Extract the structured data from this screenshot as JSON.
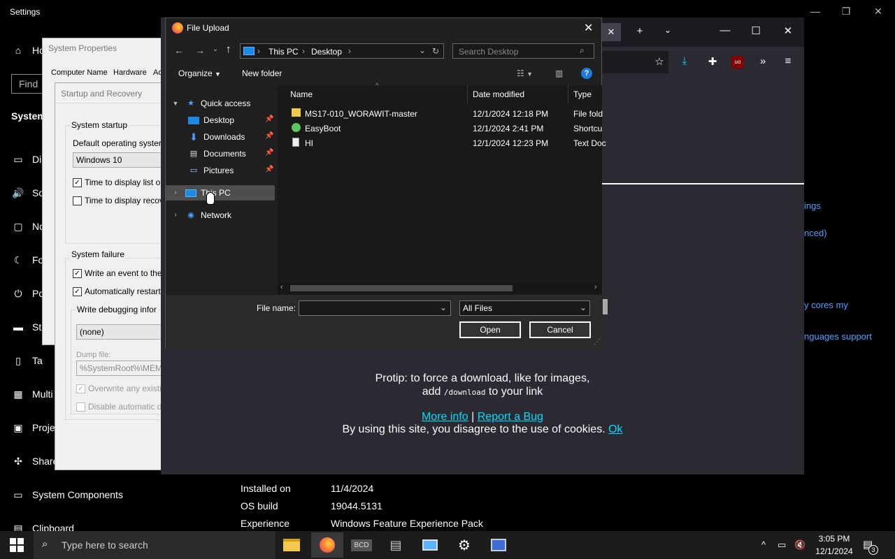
{
  "settings": {
    "title": "Settings",
    "home_label": "Ho",
    "find_placeholder": "Find",
    "section_label": "System",
    "nav": [
      {
        "icon": "display-icon",
        "glyph": "▭",
        "label": "Di"
      },
      {
        "icon": "sound-icon",
        "glyph": "🔊",
        "label": "So"
      },
      {
        "icon": "notifications-icon",
        "glyph": "▢",
        "label": "No"
      },
      {
        "icon": "focus-icon",
        "glyph": "☾",
        "label": "Fo"
      },
      {
        "icon": "power-icon",
        "glyph": "⏻",
        "label": "Po"
      },
      {
        "icon": "storage-icon",
        "glyph": "▬",
        "label": "St"
      },
      {
        "icon": "tablet-icon",
        "glyph": "▯",
        "label": "Ta"
      },
      {
        "icon": "multitasking-icon",
        "glyph": "▦",
        "label": "Multi"
      },
      {
        "icon": "projecting-icon",
        "glyph": "▣",
        "label": "Proje"
      },
      {
        "icon": "sharing-icon",
        "glyph": "✣",
        "label": "Share"
      },
      {
        "icon": "components-icon",
        "glyph": "▭",
        "label": "System Components"
      },
      {
        "icon": "clipboard-icon",
        "glyph": "▤",
        "label": "Clipboard"
      }
    ],
    "right_links": [
      "ings",
      "nced)",
      "y cores my",
      "nguages support"
    ],
    "specs": [
      {
        "label": "Installed on",
        "value": "11/4/2024"
      },
      {
        "label": "OS build",
        "value": "19044.5131"
      },
      {
        "label": "Experience",
        "value": "Windows Feature Experience Pack"
      }
    ]
  },
  "system_properties": {
    "title": "System Properties",
    "tabs": [
      "Computer Name",
      "Hardware",
      "Ad"
    ]
  },
  "startup_recovery": {
    "title": "Startup and Recovery",
    "system_startup": "System startup",
    "default_os_label": "Default operating syster",
    "default_os_value": "Windows 10",
    "time_display_list": "Time to display list o",
    "time_display_recovery": "Time to display recov",
    "system_failure": "System failure",
    "write_event": "Write an event to the",
    "auto_restart": "Automatically restart",
    "write_debug": "Write debugging infor",
    "debug_value": "(none)",
    "dump_file_label": "Dump file:",
    "dump_file_value": "%SystemRoot%\\MEM",
    "overwrite": "Overwrite any existi",
    "disable_auto": "Disable automatic d"
  },
  "browser": {
    "protip_line1": "Protip: to force a download, like for images,",
    "protip_add": "add",
    "protip_code": "/download",
    "protip_rest": "to your link",
    "more_info": "More info",
    "separator": "|",
    "report_bug": "Report a Bug",
    "cookies_text": "By using this site, you disagree to the use of cookies.",
    "ok": "Ok",
    "addon_badge": "uo"
  },
  "dialog": {
    "title": "File Upload",
    "breadcrumb": [
      "This PC",
      "Desktop"
    ],
    "search_placeholder": "Search Desktop",
    "organize": "Organize",
    "new_folder": "New folder",
    "help": "?",
    "nav": {
      "quick_access": "Quick access",
      "desktop": "Desktop",
      "downloads": "Downloads",
      "documents": "Documents",
      "pictures": "Pictures",
      "this_pc": "This PC",
      "network": "Network"
    },
    "columns": [
      "Name",
      "Date modified",
      "Type"
    ],
    "files": [
      {
        "name": "MS17-010_WORAWIT-master",
        "date": "12/1/2024 12:18 PM",
        "type": "File fold",
        "icon": "folder-icon"
      },
      {
        "name": "EasyBoot",
        "date": "12/1/2024 2:41 PM",
        "type": "Shortcu",
        "icon": "shortcut-icon"
      },
      {
        "name": "HI",
        "date": "12/1/2024 12:23 PM",
        "type": "Text Doc",
        "icon": "text-file-icon"
      }
    ],
    "file_name_label": "File name:",
    "file_name_value": "",
    "filter_value": "All Files",
    "open": "Open",
    "cancel": "Cancel"
  },
  "taskbar": {
    "search_placeholder": "Type here to search",
    "bcd_label": "BCD",
    "time": "3:05 PM",
    "date": "12/1/2024",
    "notif_count": "3"
  }
}
